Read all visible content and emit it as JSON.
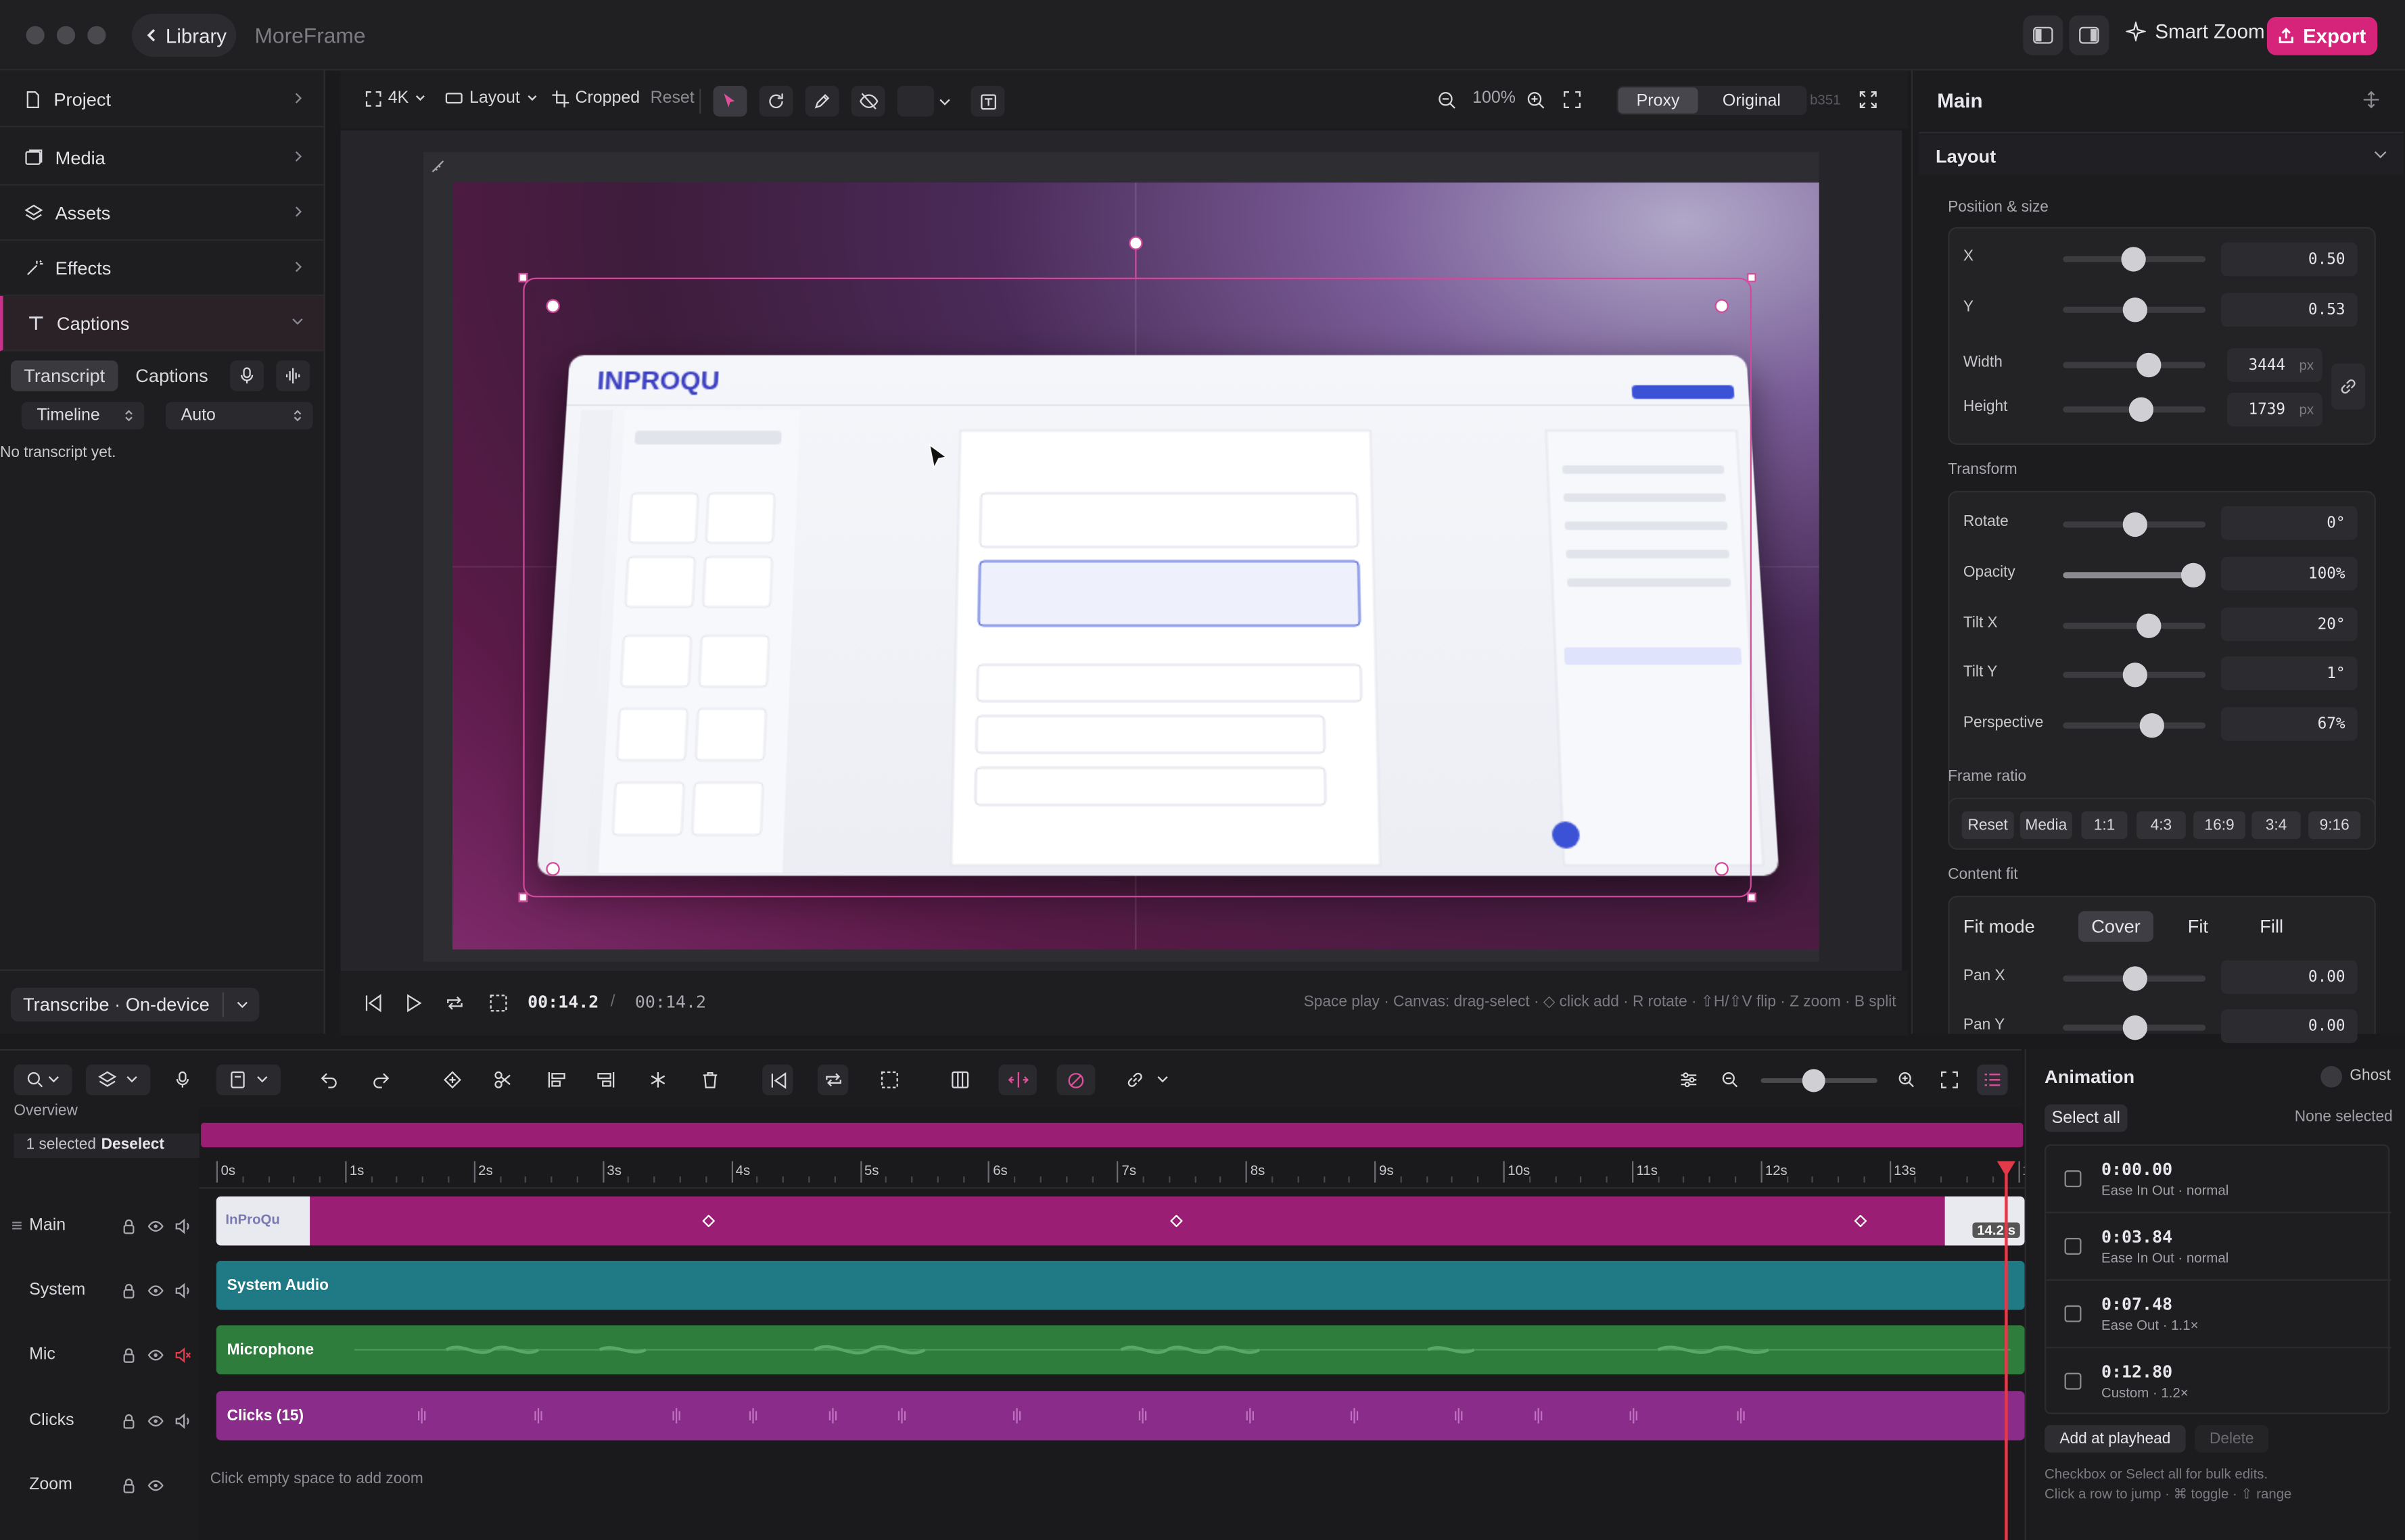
{
  "window": {
    "library_label": "Library",
    "app_name": "MoreFrame",
    "smart_zoom_label": "Smart Zoom",
    "export_label": "Export"
  },
  "sidebar": {
    "items": [
      {
        "label": "Project"
      },
      {
        "label": "Media"
      },
      {
        "label": "Assets"
      },
      {
        "label": "Effects"
      },
      {
        "label": "Captions"
      }
    ],
    "caption_tabs": [
      "Transcript",
      "Captions"
    ],
    "timeline_select": "Timeline",
    "auto_select": "Auto",
    "empty_text": "No transcript yet.",
    "transcribe_label": "Transcribe · On-device"
  },
  "toolbar": {
    "resolution": "4K",
    "layout": "Layout",
    "cropped": "Cropped",
    "reset": "Reset",
    "zoom": "100%",
    "proxy": "Proxy",
    "original": "Original",
    "build": "b351"
  },
  "playback": {
    "current": "00:14.2",
    "separator": "/",
    "total": "00:14.2",
    "hints": "Space play · Canvas: drag-select · ◇ click add · R rotate · ⇧H/⇧V flip · Z zoom · B split"
  },
  "inspector": {
    "title": "Main",
    "section": "Layout",
    "position_size": "Position & size",
    "rows": [
      {
        "label": "X",
        "value": "0.50"
      },
      {
        "label": "Y",
        "value": "0.53"
      }
    ],
    "width": {
      "label": "Width",
      "value": "3444",
      "unit": "px"
    },
    "height": {
      "label": "Height",
      "value": "1739",
      "unit": "px"
    },
    "transform_label": "Transform",
    "transform": [
      {
        "label": "Rotate",
        "value": "0°"
      },
      {
        "label": "Opacity",
        "value": "100%"
      },
      {
        "label": "Tilt X",
        "value": "20°"
      },
      {
        "label": "Tilt Y",
        "value": "1°"
      },
      {
        "label": "Perspective",
        "value": "67%"
      }
    ],
    "frame_ratio_label": "Frame ratio",
    "ratios": [
      "Reset",
      "Media",
      "1:1",
      "4:3",
      "16:9",
      "3:4",
      "9:16"
    ],
    "content_fit_label": "Content fit",
    "fit_mode_label": "Fit mode",
    "fit_modes": [
      "Cover",
      "Fit",
      "Fill"
    ],
    "pan": [
      {
        "label": "Pan X",
        "value": "0.00"
      },
      {
        "label": "Pan Y",
        "value": "0.00"
      }
    ]
  },
  "timeline": {
    "overview": "Overview",
    "selected": "1 selected",
    "deselect": "Deselect",
    "ticks": [
      "0s",
      "1s",
      "2s",
      "3s",
      "4s",
      "5s",
      "6s",
      "7s",
      "8s",
      "9s",
      "10s",
      "11s",
      "12s",
      "13s",
      "1"
    ],
    "tracks": [
      {
        "label": "Main"
      },
      {
        "label": "System"
      },
      {
        "label": "Mic"
      },
      {
        "label": "Clicks"
      },
      {
        "label": "Zoom"
      }
    ],
    "clips": {
      "main_thumb": "InProQu",
      "main_end": "14.2 s",
      "system": "System Audio",
      "mic": "Microphone",
      "clicks": "Clicks (15)",
      "zoom_hint": "Click empty space to add zoom"
    }
  },
  "animation": {
    "title": "Animation",
    "ghost": "Ghost",
    "select_all": "Select all",
    "none_selected": "None selected",
    "keyframes": [
      {
        "time": "0:00.00",
        "ease": "Ease In Out · normal"
      },
      {
        "time": "0:03.84",
        "ease": "Ease In Out · normal"
      },
      {
        "time": "0:07.48",
        "ease": "Ease Out · 1.1×"
      },
      {
        "time": "0:12.80",
        "ease": "Custom · 1.2×"
      }
    ],
    "add_at_playhead": "Add at playhead",
    "delete": "Delete",
    "help1": "Checkbox or Select all for bulk edits.",
    "help2": "Click a row to jump · ⌘ toggle · ⇧ range"
  },
  "colors": {
    "accent": "#d6247a",
    "system_clip": "#1f7a86",
    "mic_clip": "#2e7d3c",
    "clicks_clip": "#8a2c8a",
    "main_clip": "#9a1e74",
    "playhead": "#e23a4a"
  }
}
